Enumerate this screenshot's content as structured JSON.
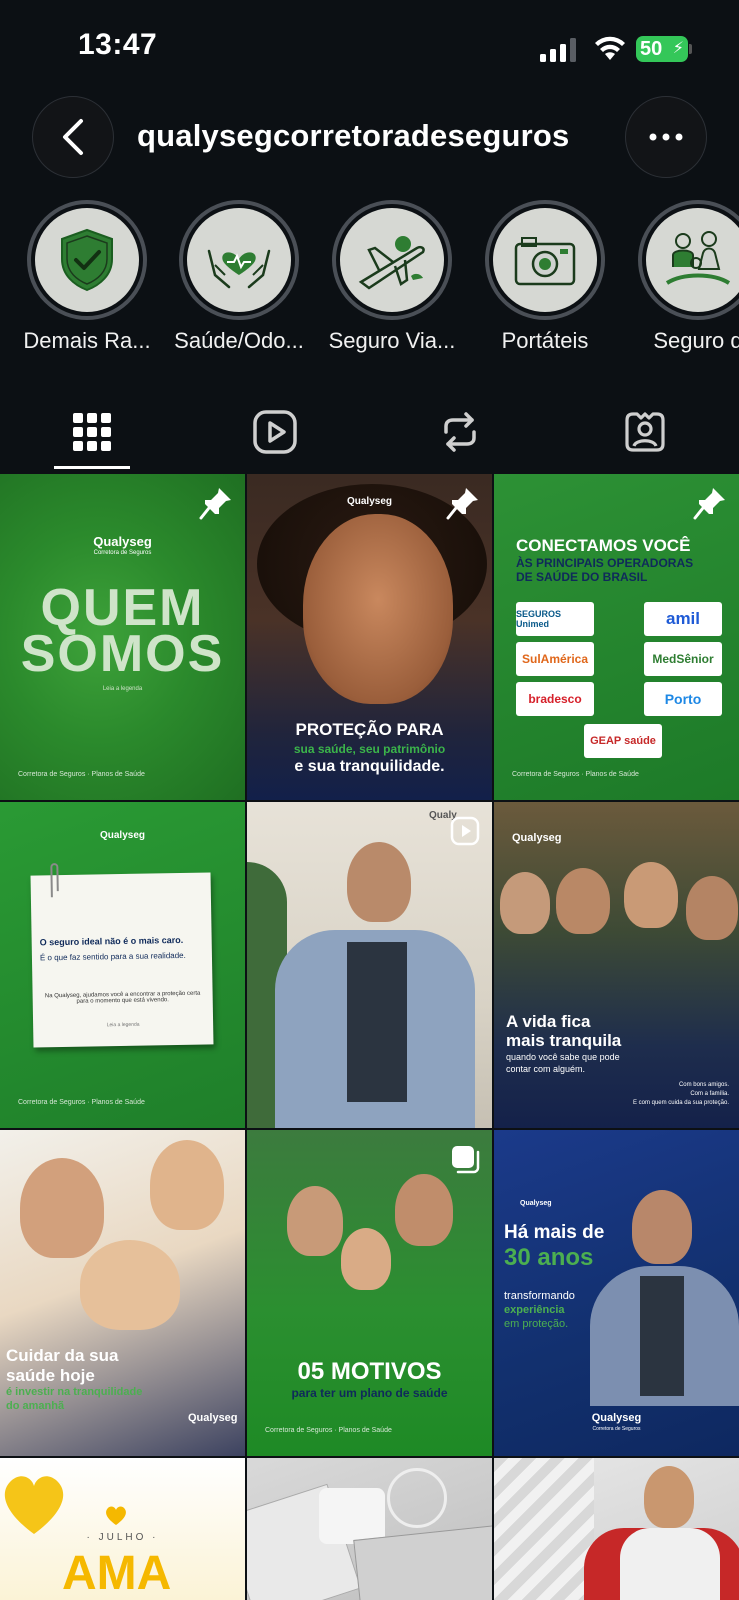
{
  "status_bar": {
    "time": "13:47",
    "battery": "50"
  },
  "header": {
    "username": "qualysegcorretoradeseguros"
  },
  "highlights": [
    {
      "label": "Demais Ra...",
      "icon": "shield-check-icon"
    },
    {
      "label": "Saúde/Odo...",
      "icon": "hands-heart-icon"
    },
    {
      "label": "Seguro Via...",
      "icon": "airplane-icon"
    },
    {
      "label": "Portáteis",
      "icon": "camera-icon"
    },
    {
      "label": "Seguro d",
      "icon": "family-icon"
    }
  ],
  "tabs": [
    {
      "name": "grid",
      "icon": "grid-icon",
      "active": true
    },
    {
      "name": "reels",
      "icon": "reels-icon"
    },
    {
      "name": "reposts",
      "icon": "repost-icon"
    },
    {
      "name": "tagged",
      "icon": "tagged-icon"
    }
  ],
  "posts": {
    "p1": {
      "brand": "Qualyseg",
      "brand_sub": "Corretora de Seguros",
      "line1": "QUEM",
      "line2": "SOMOS",
      "small": "Leia a legenda",
      "foot": "Corretora de Seguros · Planos de Saúde"
    },
    "p2": {
      "brand": "Qualyseg",
      "title1": "PROTEÇÃO PARA",
      "title2": "sua saúde, seu patrimônio",
      "title3": "e sua tranquilidade."
    },
    "p3": {
      "head1": "CONECTAMOS VOCÊ",
      "head2": "ÀS PRINCIPAIS OPERADORAS",
      "head3": "DE SAÚDE DO BRASIL",
      "logos": [
        "SEGUROS Unimed",
        "amil",
        "SulAmérica",
        "MedSênior",
        "bradesco",
        "Porto",
        "GEAP saúde"
      ],
      "foot": "Corretora de Seguros · Planos de Saúde"
    },
    "p4": {
      "brand": "Qualyseg",
      "t1": "O seguro ideal não é o mais caro.",
      "t2": "É o que faz sentido para a sua realidade.",
      "t3": "Na Qualyseg, ajudamos você a encontrar a proteção certa para o momento que está vivendo.",
      "small": "Leia a legenda",
      "foot": "Corretora de Seguros · Planos de Saúde"
    },
    "p5": {
      "brand": "Qualy"
    },
    "p6": {
      "brand": "Qualyseg",
      "t1": "A vida fica",
      "t2": "mais tranquila",
      "t3": "quando você sabe que pode",
      "t4": "contar com alguém.",
      "s1": "Com bons amigos.",
      "s2": "Com a família.",
      "s3": "E com quem cuida da sua proteção."
    },
    "p7": {
      "t1": "Cuidar da sua",
      "t2": "saúde hoje",
      "t3": "é investir na tranquilidade",
      "t4": "do amanhã",
      "brand": "Qualyseg"
    },
    "p8": {
      "t1": "05 MOTIVOS",
      "t2": "para ter um plano de saúde",
      "foot": "Corretora de Seguros · Planos de Saúde"
    },
    "p9": {
      "handle": "Qualyseg",
      "t1": "Há mais de",
      "t2": "30 anos",
      "t3": "transformando",
      "t4": "experiência",
      "t5": "em proteção.",
      "brand": "Qualyseg",
      "brand_sub": "Corretora de Seguros"
    },
    "p10": {
      "month": "· JULHO ·",
      "word": "AMA"
    }
  },
  "colors": {
    "bg": "#0c1014",
    "green": "#2b8a2c",
    "navy": "#12306e",
    "battery": "#34c759"
  }
}
